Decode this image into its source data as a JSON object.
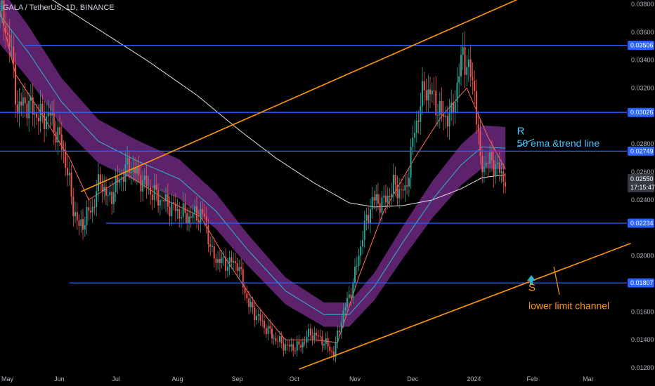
{
  "header": {
    "title": "GALA / TetherUS, 1D, BINANCE"
  },
  "colors": {
    "background": "#000000",
    "up": "#26a69a",
    "down": "#ef5350",
    "horizontal_line": "#2962ff",
    "channel_line": "#ff9800",
    "ema_band": "#7b2d8f",
    "ema_line": "#2fb7c9",
    "sma200": "#e0e0e0",
    "fast_ma": "#ff6b5a",
    "annotation_r": "#4fc3f7",
    "annotation_s": "#ff9800",
    "axis_text": "#b2b5be",
    "price_tag_bg": "#2962ff",
    "last_price_bg": "#363a45"
  },
  "chart_data": {
    "type": "candlestick",
    "symbol": "GALA / TetherUS",
    "timeframe": "1D",
    "exchange": "BINANCE",
    "x_labels": [
      "May",
      "Jun",
      "Jul",
      "Aug",
      "Sep",
      "Oct",
      "Nov",
      "Dec",
      "2024",
      "Feb",
      "Mar"
    ],
    "x_domain": [
      "2023-04-30",
      "2024-03-20"
    ],
    "y_ticks": [
      "0.01200",
      "0.01400",
      "0.01600",
      "0.02000",
      "0.02400",
      "0.02600",
      "0.02800",
      "0.03200",
      "0.03400",
      "0.03600",
      "0.03800"
    ],
    "ylim": [
      0.0117,
      0.0383
    ],
    "price_scale": [
      {
        "value": "0.03506",
        "y": 0.03506,
        "style": "level"
      },
      {
        "value": "0.03026",
        "y": 0.03026,
        "style": "level"
      },
      {
        "value": "0.02749",
        "y": 0.02749,
        "style": "level"
      },
      {
        "value": "0.02550",
        "y": 0.0255,
        "style": "last"
      },
      {
        "value": "0.02234",
        "y": 0.02234,
        "style": "level"
      },
      {
        "value": "0.01807",
        "y": 0.01807,
        "style": "level"
      }
    ],
    "countdown": "17:15:47",
    "horizontal_levels": [
      {
        "price": 0.03506,
        "from": "2023-05-13",
        "to": "2024-03-20"
      },
      {
        "price": 0.03026,
        "from": "2023-04-30",
        "to": "2024-03-20"
      },
      {
        "price": 0.02749,
        "from": "2023-04-30",
        "to": "2024-03-20"
      },
      {
        "price": 0.02234,
        "from": "2023-06-24",
        "to": "2024-03-20"
      },
      {
        "price": 0.01807,
        "from": "2023-06-05",
        "to": "2024-03-20"
      }
    ],
    "trend_lines": [
      {
        "name": "upper channel",
        "from": [
          "2023-06-11",
          0.0246
        ],
        "to": [
          "2024-02-13",
          0.0396
        ]
      },
      {
        "name": "lower channel",
        "from": [
          "2023-10-02",
          0.0119
        ],
        "to": [
          "2024-03-22",
          0.0209
        ]
      }
    ],
    "annotations": [
      {
        "text": "R",
        "color": "#4fc3f7",
        "at": [
          "2024-01-23",
          0.0287
        ]
      },
      {
        "text": "50 ema &trend line",
        "color": "#4fc3f7",
        "at": [
          "2024-01-23",
          0.0278
        ]
      },
      {
        "text": "S",
        "color": "#ff9800",
        "at": [
          "2024-01-29",
          0.0175
        ]
      },
      {
        "text": "lower limit channel",
        "color": "#ff9800",
        "at": [
          "2024-01-29",
          0.0162
        ]
      }
    ],
    "price_path": [
      [
        "2023-04-30",
        0.0375
      ],
      [
        "2023-05-05",
        0.0355
      ],
      [
        "2023-05-09",
        0.0305
      ],
      [
        "2023-05-13",
        0.031
      ],
      [
        "2023-05-20",
        0.03
      ],
      [
        "2023-05-26",
        0.03
      ],
      [
        "2023-06-02",
        0.0275
      ],
      [
        "2023-06-07",
        0.0235
      ],
      [
        "2023-06-10",
        0.022
      ],
      [
        "2023-06-17",
        0.0235
      ],
      [
        "2023-06-21",
        0.0255
      ],
      [
        "2023-06-25",
        0.024
      ],
      [
        "2023-07-01",
        0.0255
      ],
      [
        "2023-07-06",
        0.0265
      ],
      [
        "2023-07-12",
        0.0255
      ],
      [
        "2023-07-18",
        0.0245
      ],
      [
        "2023-07-25",
        0.0238
      ],
      [
        "2023-07-31",
        0.0232
      ],
      [
        "2023-08-06",
        0.0228
      ],
      [
        "2023-08-10",
        0.023
      ],
      [
        "2023-08-14",
        0.0228
      ],
      [
        "2023-08-18",
        0.02
      ],
      [
        "2023-08-24",
        0.0195
      ],
      [
        "2023-08-31",
        0.0195
      ],
      [
        "2023-09-06",
        0.0165
      ],
      [
        "2023-09-14",
        0.015
      ],
      [
        "2023-09-20",
        0.014
      ],
      [
        "2023-09-26",
        0.0135
      ],
      [
        "2023-10-02",
        0.0135
      ],
      [
        "2023-10-08",
        0.0145
      ],
      [
        "2023-10-14",
        0.014
      ],
      [
        "2023-10-20",
        0.013
      ],
      [
        "2023-10-24",
        0.0155
      ],
      [
        "2023-10-30",
        0.018
      ],
      [
        "2023-11-04",
        0.0215
      ],
      [
        "2023-11-09",
        0.024
      ],
      [
        "2023-11-15",
        0.0238
      ],
      [
        "2023-11-20",
        0.025
      ],
      [
        "2023-11-26",
        0.0245
      ],
      [
        "2023-12-01",
        0.029
      ],
      [
        "2023-12-06",
        0.032
      ],
      [
        "2023-12-10",
        0.0315
      ],
      [
        "2023-12-15",
        0.03
      ],
      [
        "2023-12-20",
        0.03
      ],
      [
        "2023-12-26",
        0.0345
      ],
      [
        "2024-01-01",
        0.032
      ],
      [
        "2024-01-04",
        0.0265
      ],
      [
        "2024-01-10",
        0.0268
      ],
      [
        "2024-01-14",
        0.026
      ],
      [
        "2024-01-17",
        0.0255
      ]
    ],
    "ema50": [
      [
        "2023-04-30",
        0.0372
      ],
      [
        "2023-05-15",
        0.0345
      ],
      [
        "2023-06-01",
        0.031
      ],
      [
        "2023-06-20",
        0.0282
      ],
      [
        "2023-07-10",
        0.0268
      ],
      [
        "2023-08-01",
        0.0255
      ],
      [
        "2023-08-20",
        0.0232
      ],
      [
        "2023-09-05",
        0.0205
      ],
      [
        "2023-09-25",
        0.0175
      ],
      [
        "2023-10-15",
        0.0158
      ],
      [
        "2023-10-28",
        0.0158
      ],
      [
        "2023-11-10",
        0.0178
      ],
      [
        "2023-11-25",
        0.021
      ],
      [
        "2023-12-10",
        0.024
      ],
      [
        "2023-12-25",
        0.0265
      ],
      [
        "2024-01-05",
        0.0278
      ],
      [
        "2024-01-17",
        0.0277
      ]
    ],
    "fast_ma": [
      [
        "2023-04-30",
        0.0375
      ],
      [
        "2023-05-08",
        0.033
      ],
      [
        "2023-05-20",
        0.0305
      ],
      [
        "2023-06-05",
        0.027
      ],
      [
        "2023-06-15",
        0.024
      ],
      [
        "2023-07-05",
        0.0258
      ],
      [
        "2023-07-25",
        0.024
      ],
      [
        "2023-08-12",
        0.0228
      ],
      [
        "2023-08-25",
        0.0198
      ],
      [
        "2023-09-10",
        0.0165
      ],
      [
        "2023-09-25",
        0.014
      ],
      [
        "2023-10-10",
        0.014
      ],
      [
        "2023-10-22",
        0.0138
      ],
      [
        "2023-11-02",
        0.0185
      ],
      [
        "2023-11-15",
        0.0232
      ],
      [
        "2023-12-01",
        0.027
      ],
      [
        "2023-12-15",
        0.03
      ],
      [
        "2023-12-28",
        0.032
      ],
      [
        "2024-01-08",
        0.0285
      ],
      [
        "2024-01-17",
        0.0262
      ]
    ],
    "sma200": [
      [
        "2023-05-25",
        0.0385
      ],
      [
        "2023-06-20",
        0.0362
      ],
      [
        "2023-07-15",
        0.034
      ],
      [
        "2023-08-10",
        0.0315
      ],
      [
        "2023-09-01",
        0.029
      ],
      [
        "2023-09-20",
        0.027
      ],
      [
        "2023-10-10",
        0.0252
      ],
      [
        "2023-10-28",
        0.0238
      ],
      [
        "2023-11-10",
        0.0235
      ],
      [
        "2023-11-25",
        0.0236
      ],
      [
        "2023-12-10",
        0.024
      ],
      [
        "2023-12-25",
        0.0248
      ],
      [
        "2024-01-05",
        0.0256
      ],
      [
        "2024-01-17",
        0.0258
      ]
    ]
  }
}
